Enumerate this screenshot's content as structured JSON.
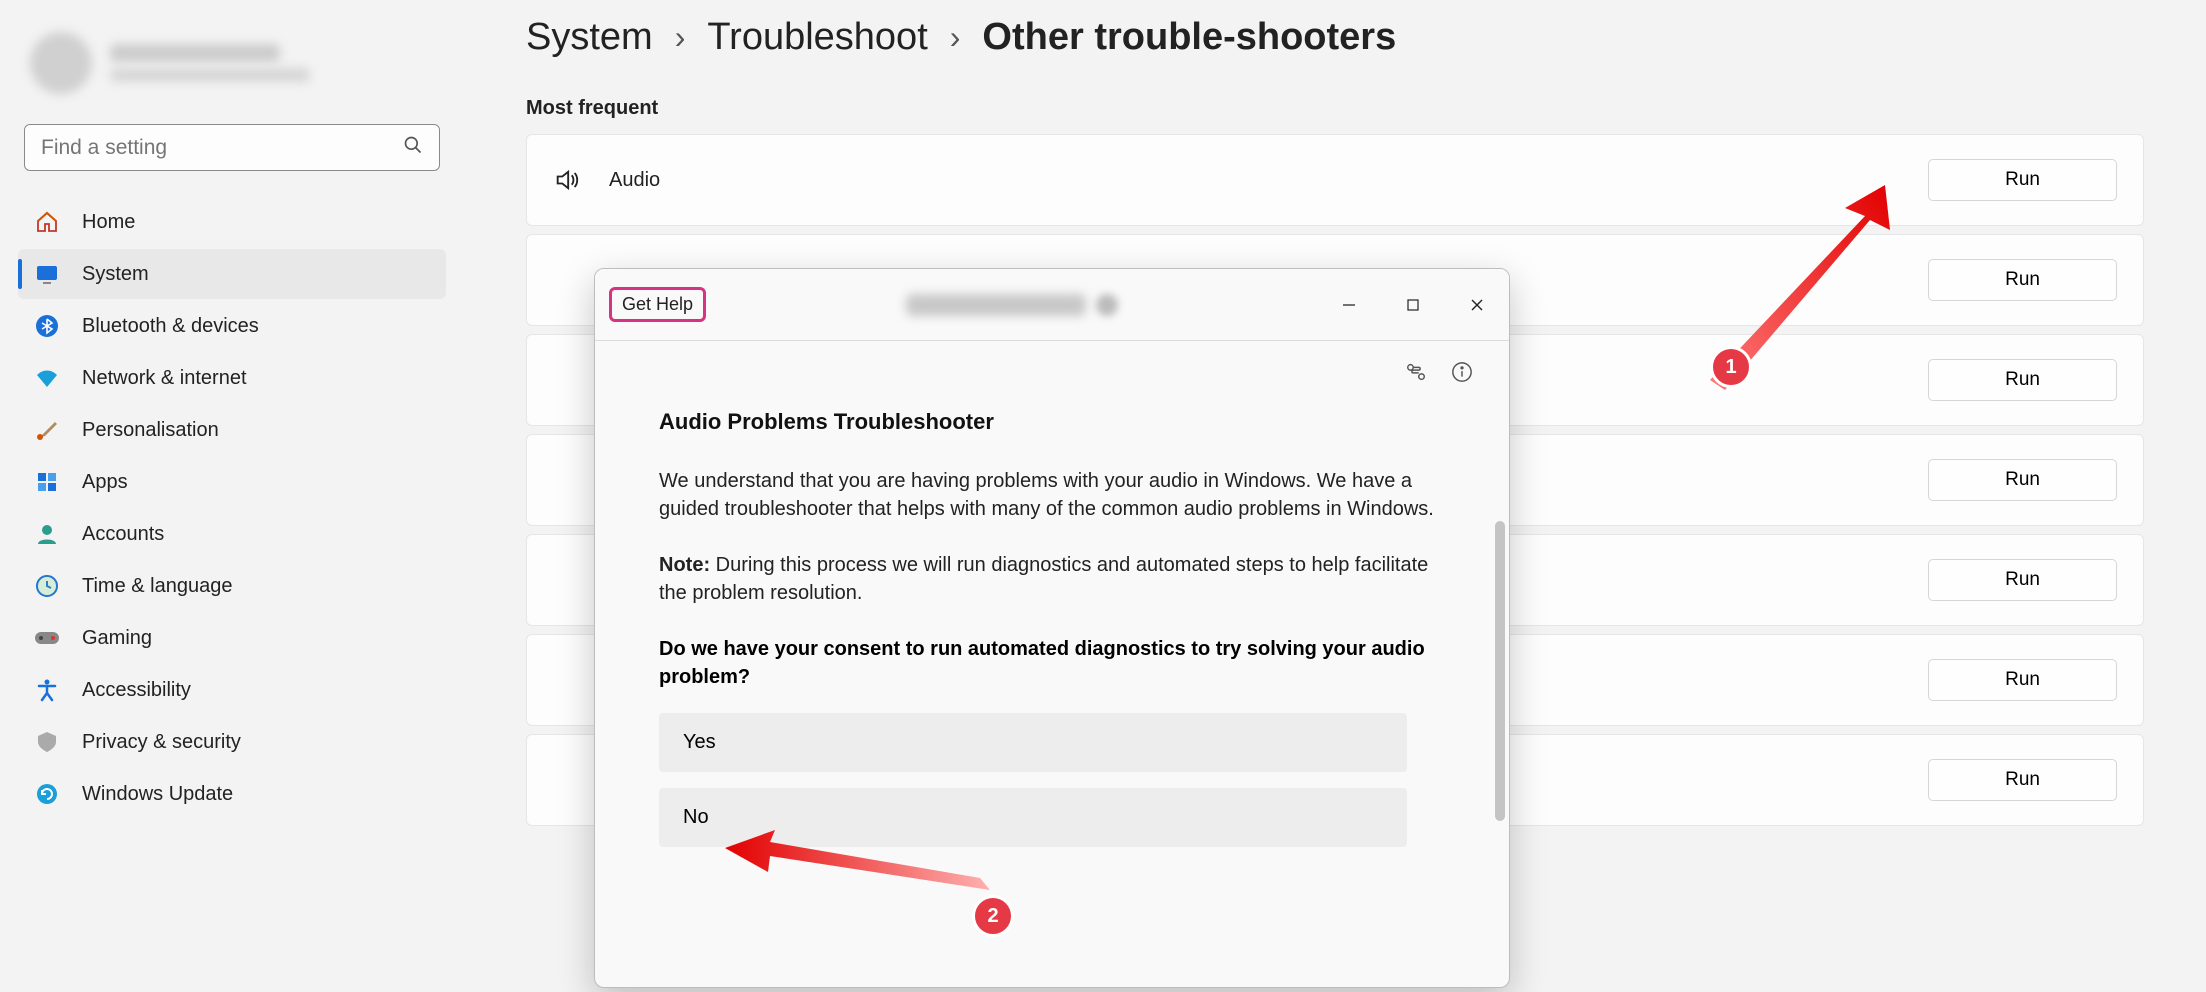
{
  "search": {
    "placeholder": "Find a setting"
  },
  "sidebar": {
    "items": [
      {
        "label": "Home"
      },
      {
        "label": "System"
      },
      {
        "label": "Bluetooth & devices"
      },
      {
        "label": "Network & internet"
      },
      {
        "label": "Personalisation"
      },
      {
        "label": "Apps"
      },
      {
        "label": "Accounts"
      },
      {
        "label": "Time & language"
      },
      {
        "label": "Gaming"
      },
      {
        "label": "Accessibility"
      },
      {
        "label": "Privacy & security"
      },
      {
        "label": "Windows Update"
      }
    ]
  },
  "breadcrumb": {
    "a": "System",
    "b": "Troubleshoot",
    "c": "Other trouble-shooters"
  },
  "section_title": "Most frequent",
  "rows": [
    {
      "label": "Audio",
      "btn": "Run"
    },
    {
      "label": "",
      "btn": "Run"
    },
    {
      "label": "",
      "btn": "Run"
    },
    {
      "label": "",
      "btn": "Run"
    },
    {
      "label": "",
      "btn": "Run"
    },
    {
      "label": "",
      "btn": "Run"
    },
    {
      "label": "",
      "btn": "Run"
    }
  ],
  "popup": {
    "app_name": "Get Help",
    "title": "Audio Problems Troubleshooter",
    "p1": "We understand that you are having problems with your audio in Windows. We have a guided troubleshooter that helps with many of the common audio problems in Windows.",
    "note_label": "Note:",
    "note_body": " During this process we will run diagnostics and automated steps to help facilitate the problem resolution.",
    "question": "Do we have your consent to run automated diagnostics to try solving your audio problem?",
    "opt_yes": "Yes",
    "opt_no": "No"
  },
  "annotations": {
    "badge1": "1",
    "badge2": "2"
  }
}
